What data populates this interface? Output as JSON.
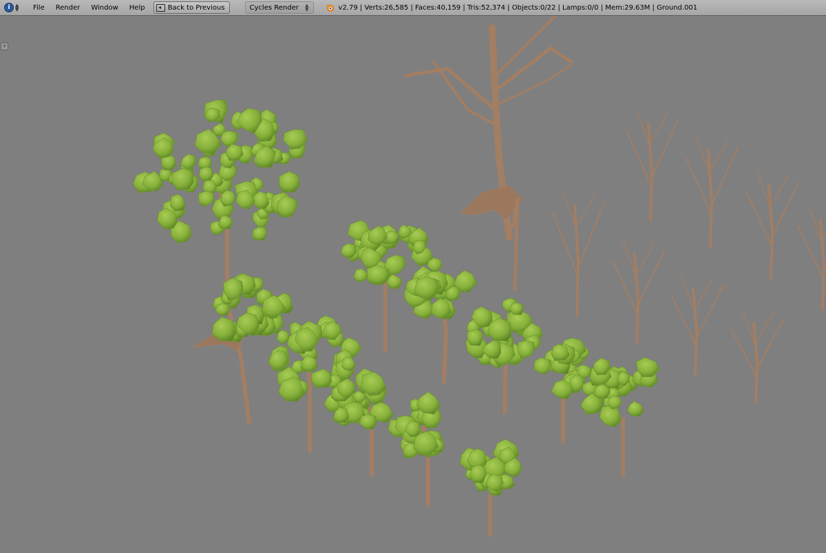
{
  "header": {
    "info_icon": "info-icon",
    "menu": [
      "File",
      "Render",
      "Window",
      "Help"
    ],
    "back_button": "Back to Previous",
    "render_engine": "Cycles Render",
    "stats": "v2.79 | Verts:26,585 | Faces:40,159 | Tris:52,374 | Objects:0/22 | Lamps:0/0 | Mem:29.63M | Ground.001"
  },
  "colors": {
    "background": "#7f7f7f",
    "foliage": "#8ab43a",
    "foliage_dark": "#5f8a22",
    "bark": "#a27e63",
    "bark_dark": "#7d5f4a"
  }
}
